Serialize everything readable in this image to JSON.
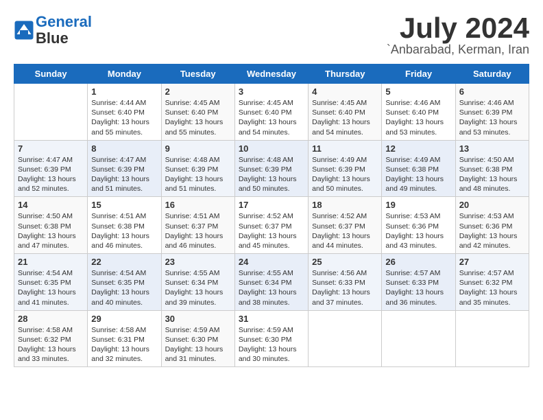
{
  "header": {
    "logo_line1": "General",
    "logo_line2": "Blue",
    "month": "July 2024",
    "location": "`Anbarabad, Kerman, Iran"
  },
  "weekdays": [
    "Sunday",
    "Monday",
    "Tuesday",
    "Wednesday",
    "Thursday",
    "Friday",
    "Saturday"
  ],
  "weeks": [
    [
      {
        "day": "",
        "info": ""
      },
      {
        "day": "1",
        "info": "Sunrise: 4:44 AM\nSunset: 6:40 PM\nDaylight: 13 hours\nand 55 minutes."
      },
      {
        "day": "2",
        "info": "Sunrise: 4:45 AM\nSunset: 6:40 PM\nDaylight: 13 hours\nand 55 minutes."
      },
      {
        "day": "3",
        "info": "Sunrise: 4:45 AM\nSunset: 6:40 PM\nDaylight: 13 hours\nand 54 minutes."
      },
      {
        "day": "4",
        "info": "Sunrise: 4:45 AM\nSunset: 6:40 PM\nDaylight: 13 hours\nand 54 minutes."
      },
      {
        "day": "5",
        "info": "Sunrise: 4:46 AM\nSunset: 6:40 PM\nDaylight: 13 hours\nand 53 minutes."
      },
      {
        "day": "6",
        "info": "Sunrise: 4:46 AM\nSunset: 6:39 PM\nDaylight: 13 hours\nand 53 minutes."
      }
    ],
    [
      {
        "day": "7",
        "info": "Sunrise: 4:47 AM\nSunset: 6:39 PM\nDaylight: 13 hours\nand 52 minutes."
      },
      {
        "day": "8",
        "info": "Sunrise: 4:47 AM\nSunset: 6:39 PM\nDaylight: 13 hours\nand 51 minutes."
      },
      {
        "day": "9",
        "info": "Sunrise: 4:48 AM\nSunset: 6:39 PM\nDaylight: 13 hours\nand 51 minutes."
      },
      {
        "day": "10",
        "info": "Sunrise: 4:48 AM\nSunset: 6:39 PM\nDaylight: 13 hours\nand 50 minutes."
      },
      {
        "day": "11",
        "info": "Sunrise: 4:49 AM\nSunset: 6:39 PM\nDaylight: 13 hours\nand 50 minutes."
      },
      {
        "day": "12",
        "info": "Sunrise: 4:49 AM\nSunset: 6:38 PM\nDaylight: 13 hours\nand 49 minutes."
      },
      {
        "day": "13",
        "info": "Sunrise: 4:50 AM\nSunset: 6:38 PM\nDaylight: 13 hours\nand 48 minutes."
      }
    ],
    [
      {
        "day": "14",
        "info": "Sunrise: 4:50 AM\nSunset: 6:38 PM\nDaylight: 13 hours\nand 47 minutes."
      },
      {
        "day": "15",
        "info": "Sunrise: 4:51 AM\nSunset: 6:38 PM\nDaylight: 13 hours\nand 46 minutes."
      },
      {
        "day": "16",
        "info": "Sunrise: 4:51 AM\nSunset: 6:37 PM\nDaylight: 13 hours\nand 46 minutes."
      },
      {
        "day": "17",
        "info": "Sunrise: 4:52 AM\nSunset: 6:37 PM\nDaylight: 13 hours\nand 45 minutes."
      },
      {
        "day": "18",
        "info": "Sunrise: 4:52 AM\nSunset: 6:37 PM\nDaylight: 13 hours\nand 44 minutes."
      },
      {
        "day": "19",
        "info": "Sunrise: 4:53 AM\nSunset: 6:36 PM\nDaylight: 13 hours\nand 43 minutes."
      },
      {
        "day": "20",
        "info": "Sunrise: 4:53 AM\nSunset: 6:36 PM\nDaylight: 13 hours\nand 42 minutes."
      }
    ],
    [
      {
        "day": "21",
        "info": "Sunrise: 4:54 AM\nSunset: 6:35 PM\nDaylight: 13 hours\nand 41 minutes."
      },
      {
        "day": "22",
        "info": "Sunrise: 4:54 AM\nSunset: 6:35 PM\nDaylight: 13 hours\nand 40 minutes."
      },
      {
        "day": "23",
        "info": "Sunrise: 4:55 AM\nSunset: 6:34 PM\nDaylight: 13 hours\nand 39 minutes."
      },
      {
        "day": "24",
        "info": "Sunrise: 4:55 AM\nSunset: 6:34 PM\nDaylight: 13 hours\nand 38 minutes."
      },
      {
        "day": "25",
        "info": "Sunrise: 4:56 AM\nSunset: 6:33 PM\nDaylight: 13 hours\nand 37 minutes."
      },
      {
        "day": "26",
        "info": "Sunrise: 4:57 AM\nSunset: 6:33 PM\nDaylight: 13 hours\nand 36 minutes."
      },
      {
        "day": "27",
        "info": "Sunrise: 4:57 AM\nSunset: 6:32 PM\nDaylight: 13 hours\nand 35 minutes."
      }
    ],
    [
      {
        "day": "28",
        "info": "Sunrise: 4:58 AM\nSunset: 6:32 PM\nDaylight: 13 hours\nand 33 minutes."
      },
      {
        "day": "29",
        "info": "Sunrise: 4:58 AM\nSunset: 6:31 PM\nDaylight: 13 hours\nand 32 minutes."
      },
      {
        "day": "30",
        "info": "Sunrise: 4:59 AM\nSunset: 6:30 PM\nDaylight: 13 hours\nand 31 minutes."
      },
      {
        "day": "31",
        "info": "Sunrise: 4:59 AM\nSunset: 6:30 PM\nDaylight: 13 hours\nand 30 minutes."
      },
      {
        "day": "",
        "info": ""
      },
      {
        "day": "",
        "info": ""
      },
      {
        "day": "",
        "info": ""
      }
    ]
  ]
}
